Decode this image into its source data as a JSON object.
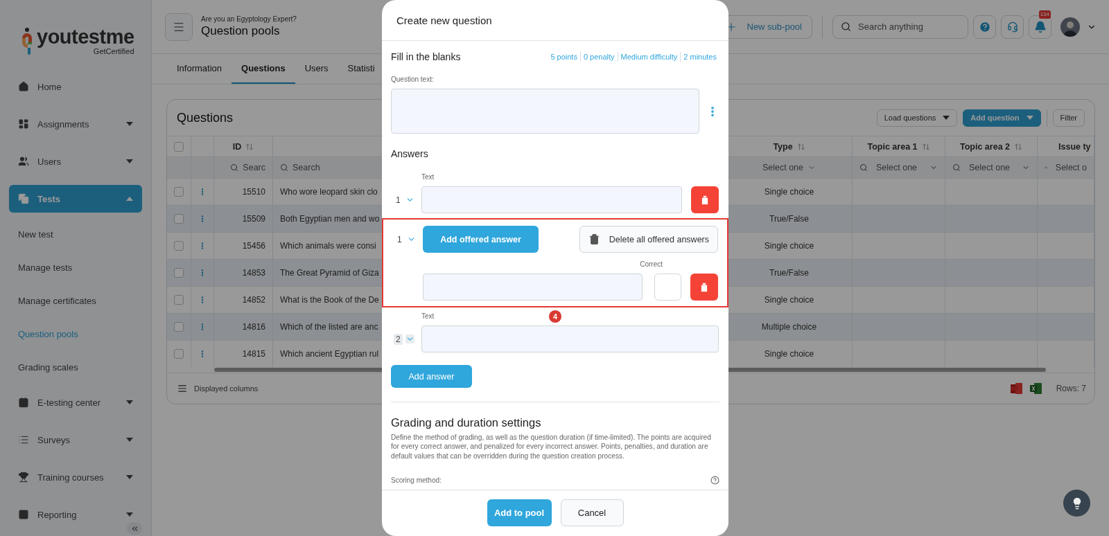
{
  "sidebar": {
    "logo": {
      "name": "youtestme",
      "tagline": "GetCertified"
    },
    "items": [
      {
        "label": "Home",
        "selected": false
      },
      {
        "label": "Assignments",
        "expanded": false,
        "selected": false
      },
      {
        "label": "Users",
        "expanded": false,
        "selected": false
      },
      {
        "label": "Tests",
        "expanded": true,
        "selected": true,
        "children": [
          {
            "label": "New test",
            "selected": false
          },
          {
            "label": "Manage tests",
            "selected": false
          },
          {
            "label": "Manage certificates",
            "selected": false
          },
          {
            "label": "Question pools",
            "selected": true
          },
          {
            "label": "Grading scales",
            "selected": false
          }
        ]
      },
      {
        "label": "E-testing center",
        "expanded": false,
        "selected": false
      },
      {
        "label": "Surveys",
        "expanded": false,
        "selected": false
      },
      {
        "label": "Training courses",
        "expanded": false,
        "selected": false
      },
      {
        "label": "Reporting",
        "expanded": false,
        "selected": false
      }
    ]
  },
  "header": {
    "subtitle": "Are you an Egyptology Expert?",
    "title": "Question pools",
    "new_button": "New sub-pool",
    "search": {
      "placeholder": "Search anything"
    },
    "notification_count": "134"
  },
  "tabs": [
    {
      "label": "Information",
      "selected": false
    },
    {
      "label": "Questions",
      "selected": true
    },
    {
      "label": "Users",
      "selected": false
    },
    {
      "label": "Statisti",
      "selected": false
    }
  ],
  "questions": {
    "title": "Questions",
    "all_selected": false,
    "load_button": "Load questions",
    "add_button": "Add question",
    "filter_button": "Filter",
    "columns": [
      {
        "label": "ID",
        "filter": "Searc"
      },
      {
        "filter": "Search"
      },
      {
        "label": "Type",
        "filter": "Select one"
      },
      {
        "label": "Topic area 1",
        "filter": "Select one"
      },
      {
        "label": "Topic area 2",
        "filter": "Select one"
      },
      {
        "label": "Issue ty",
        "filter": "Select o"
      }
    ],
    "rows": [
      {
        "checked": false,
        "id": "15510",
        "question": "Who wore leopard skin clo",
        "type": "Single choice"
      },
      {
        "checked": false,
        "id": "15509",
        "question": "Both Egyptian men and wo",
        "type": "True/False"
      },
      {
        "checked": false,
        "id": "15456",
        "question": "Which animals were consi",
        "type": "Single choice"
      },
      {
        "checked": false,
        "id": "14853",
        "question": "The Great Pyramid of Giza",
        "type": "True/False"
      },
      {
        "checked": false,
        "id": "14852",
        "question": "What is the Book of the De",
        "type": "Single choice"
      },
      {
        "checked": false,
        "id": "14816",
        "question": "Which of the listed are anc",
        "type": "Multiple choice"
      },
      {
        "checked": false,
        "id": "14815",
        "question": "Which ancient Egyptian rul",
        "type": "Single choice"
      }
    ],
    "footer_label": "Displayed columns",
    "row_count": "Rows: 7"
  },
  "modal": {
    "title": "Create new question",
    "question_type": "Fill in the blanks",
    "meta": [
      "5 points",
      "0 penalty",
      "Medium difficulty",
      "2 minutes"
    ],
    "question_label": "Question text:",
    "answers_title": "Answers",
    "answers": [
      {
        "kind": "text",
        "label": "Text",
        "number": "1",
        "disabled": false
      },
      {
        "kind": "offered",
        "number": "1",
        "add_label": "Add offered answer",
        "delete_all_label": "Delete all offered answers",
        "correct_label": "Correct",
        "correct": false,
        "highlighted": true,
        "badge": "4"
      },
      {
        "kind": "text",
        "label": "Text",
        "number": "2",
        "disabled": true
      }
    ],
    "add_answer": "Add answer",
    "grading_title": "Grading and duration settings",
    "grading_description": "Define the method of grading, as well as the question duration (if time-limited). The points are acquired for every correct answer, and penalized for every incorrect answer. Points, penalties, and duration are default values that can be overridden during the question creation process.",
    "scoring_label": "Scoring method:",
    "primary_button": "Add to pool",
    "cancel_button": "Cancel"
  }
}
